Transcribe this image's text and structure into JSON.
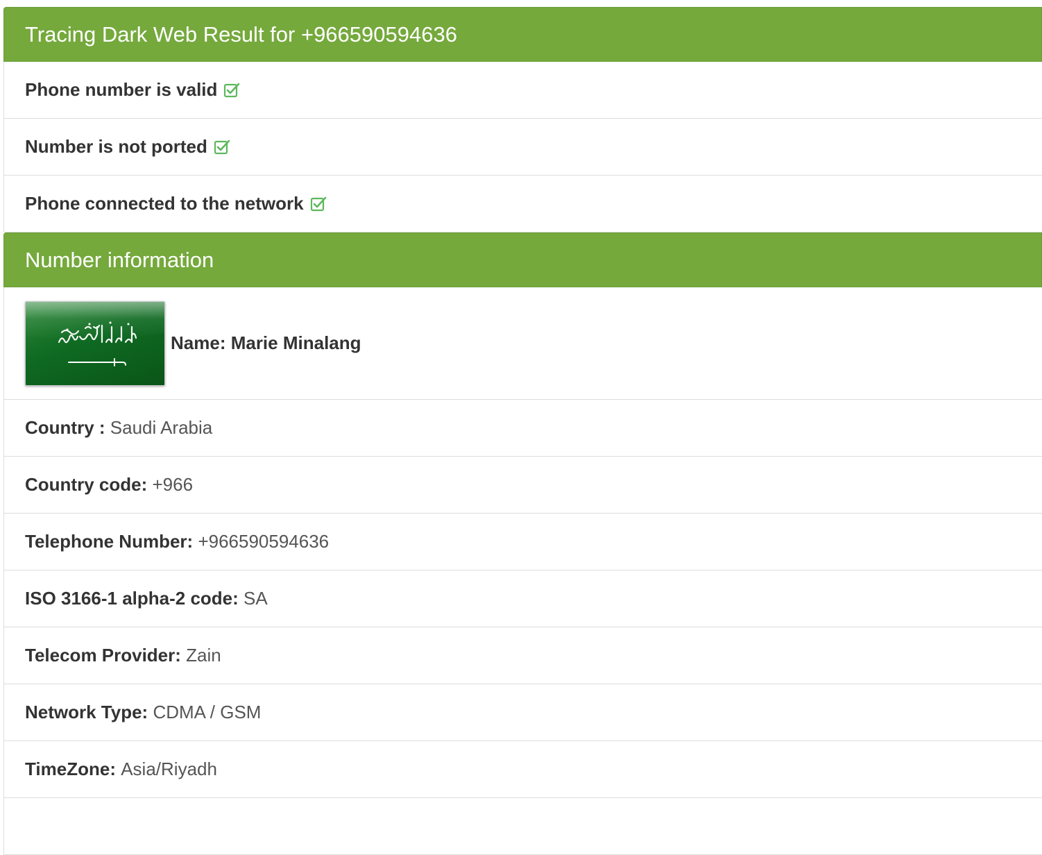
{
  "header": {
    "title": "Tracing Dark Web Result for +966590594636"
  },
  "status_items": [
    {
      "label": "Phone number is valid",
      "icon": "check-square-icon"
    },
    {
      "label": "Number is not ported",
      "icon": "check-square-icon"
    },
    {
      "label": "Phone connected to the network",
      "icon": "check-square-icon"
    }
  ],
  "info_section": {
    "title": "Number information",
    "flag_icon": "saudi-arabia-flag-icon",
    "name": "Name: Marie Minalang",
    "rows": [
      {
        "label": "Country :",
        "value": "Saudi Arabia"
      },
      {
        "label": "Country code:",
        "value": "+966"
      },
      {
        "label": "Telephone Number:",
        "value": "+966590594636"
      },
      {
        "label": "ISO 3166-1 alpha-2 code:",
        "value": "SA"
      },
      {
        "label": "Telecom Provider:",
        "value": "Zain"
      },
      {
        "label": "Network Type:",
        "value": "CDMA / GSM"
      },
      {
        "label": "TimeZone:",
        "value": "Asia/Riyadh"
      }
    ]
  },
  "colors": {
    "accent": "#75a93c",
    "check": "#5cb85c"
  }
}
